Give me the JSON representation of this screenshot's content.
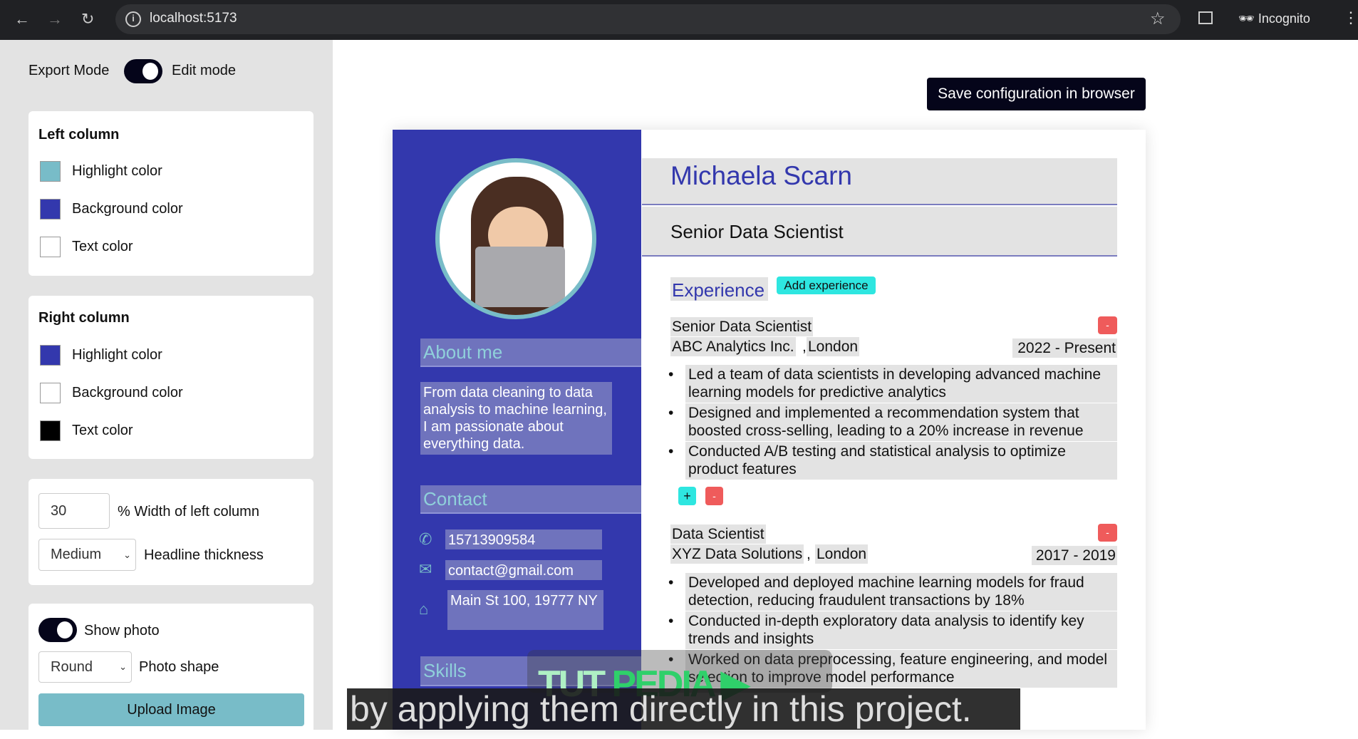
{
  "browser": {
    "url": "localhost:5173",
    "incognito_label": "Incognito"
  },
  "sidebar": {
    "export_mode": "Export Mode",
    "edit_mode": "Edit mode",
    "mode_toggle_on": true,
    "left_column": {
      "title": "Left column",
      "highlight": "Highlight color",
      "background": "Background color",
      "text": "Text color",
      "colors": {
        "highlight": "#78bcc8",
        "background": "#3338ad",
        "text": "#ffffff"
      }
    },
    "right_column": {
      "title": "Right column",
      "highlight": "Highlight color",
      "background": "Background color",
      "text": "Text color",
      "colors": {
        "highlight": "#3338ad",
        "background": "#ffffff",
        "text": "#000000"
      }
    },
    "width_value": "30",
    "width_label": "% Width of left column",
    "thickness_value": "Medium",
    "thickness_label": "Headline thickness",
    "show_photo": "Show photo",
    "show_photo_on": true,
    "shape_value": "Round",
    "shape_label": "Photo shape",
    "upload": "Upload Image"
  },
  "save_button": "Save configuration in browser",
  "resume": {
    "about_header": "About me",
    "about_text": "From data cleaning to data analysis to machine learning, I am passionate about everything data.",
    "contact_header": "Contact",
    "phone": "15713909584",
    "email": "contact@gmail.com",
    "address": "Main St 100, 19777 NY",
    "skills_header": "Skills",
    "name": "Michaela Scarn",
    "title": "Senior Data Scientist",
    "experience_header": "Experience",
    "add_experience": "Add experience",
    "jobs": [
      {
        "title": "Senior Data Scientist",
        "company": "ABC Analytics Inc.",
        "city": "London",
        "dates": "2022 - Present",
        "bullets": [
          "Led a team of data scientists in developing advanced machine learning models for predictive analytics",
          "Designed and implemented a recommendation system that boosted cross-selling, leading to a 20% increase in revenue",
          "Conducted A/B testing and statistical analysis to optimize product features"
        ]
      },
      {
        "title": "Data Scientist",
        "company": "XYZ Data Solutions",
        "city": "London",
        "dates": "2017 - 2019",
        "bullets": [
          "Developed and deployed machine learning models for fraud detection, reducing fraudulent transactions by 18%",
          "Conducted in-depth exploratory data analysis to identify key trends and insights",
          "Worked on data preprocessing, feature engineering, and model selection to improve model performance"
        ]
      }
    ],
    "plus": "+",
    "minus": "-"
  },
  "overlay": {
    "caption": "by applying them directly in this project.",
    "watermark": "TUT PEDIA"
  }
}
